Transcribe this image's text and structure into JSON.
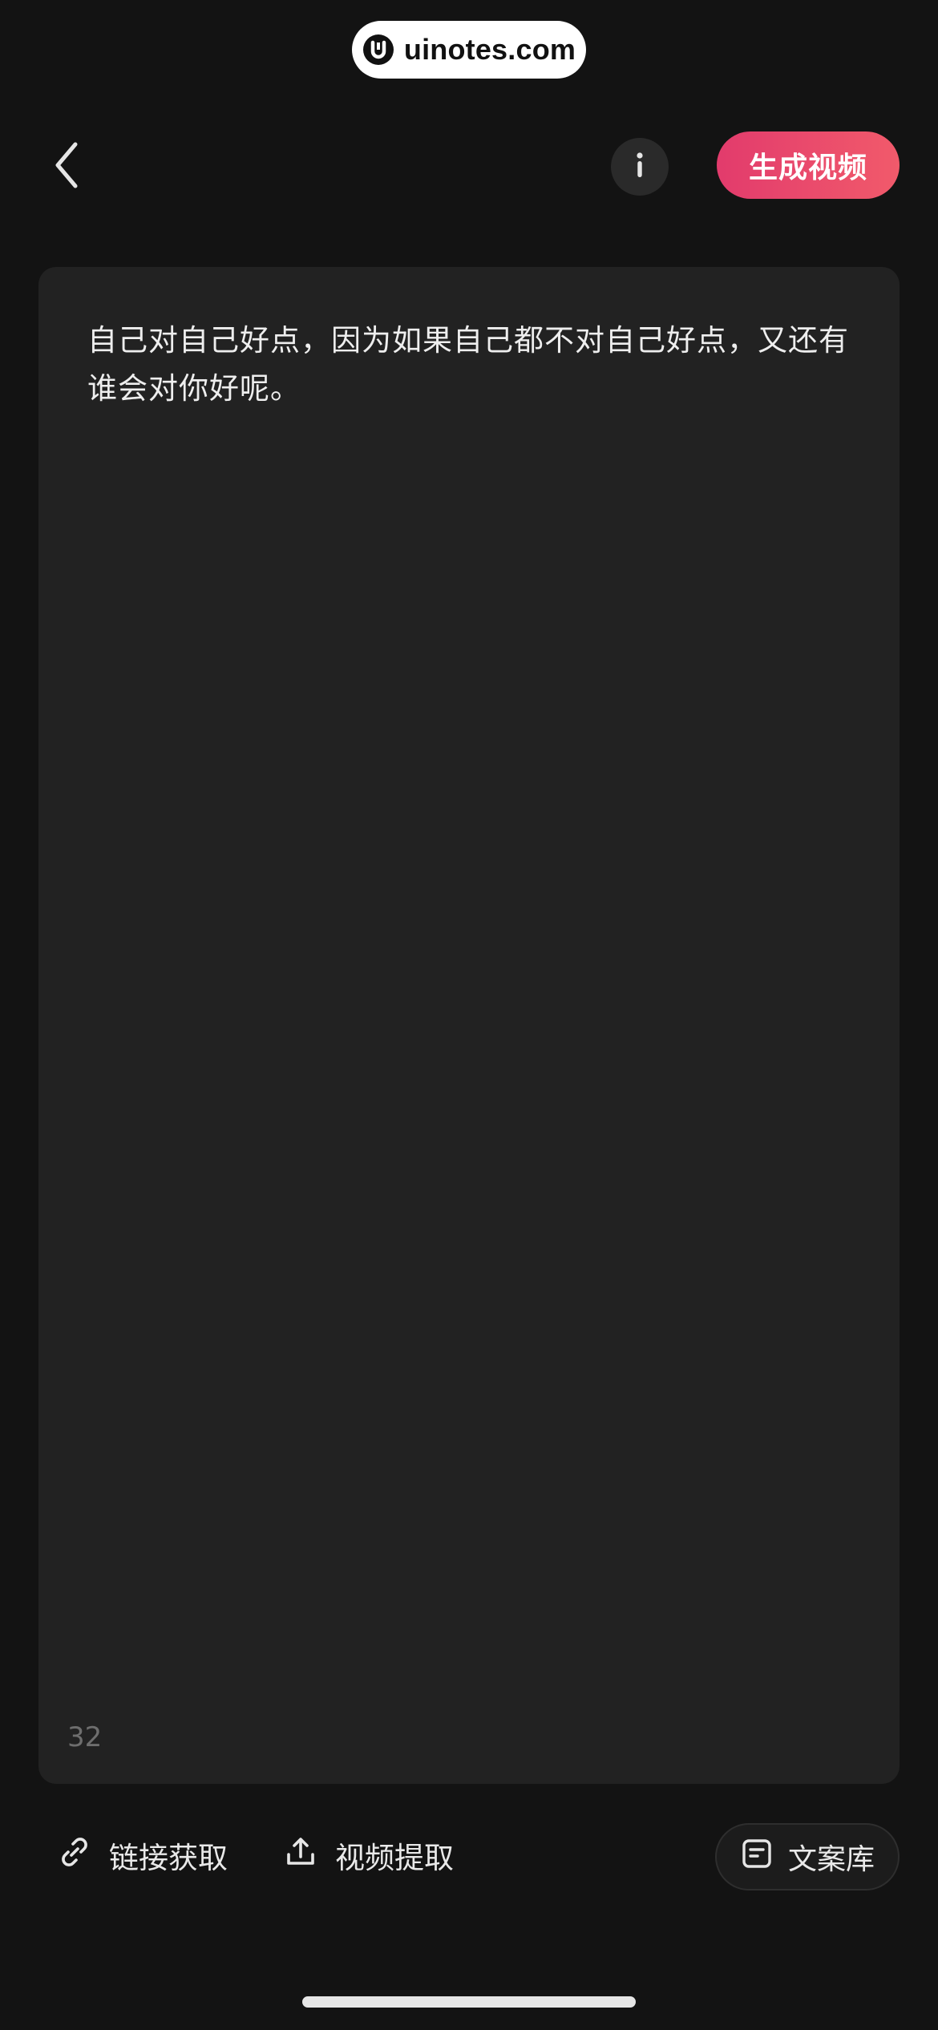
{
  "watermark": {
    "text": "uinotes.com",
    "logo_icon": "uinotes-logo-icon"
  },
  "topbar": {
    "back_icon": "chevron-left-icon",
    "info_icon": "info-icon",
    "generate_label": "生成视频",
    "accent_color": "#e8456b"
  },
  "editor": {
    "text": "自己对自己好点，因为如果自己都不对自己好点，又还有谁会对你好呢。",
    "char_count": "32"
  },
  "actions": {
    "link": {
      "label": "链接获取",
      "icon": "link-icon"
    },
    "video": {
      "label": "视频提取",
      "icon": "upload-icon"
    },
    "library": {
      "label": "文案库",
      "icon": "document-icon"
    }
  }
}
